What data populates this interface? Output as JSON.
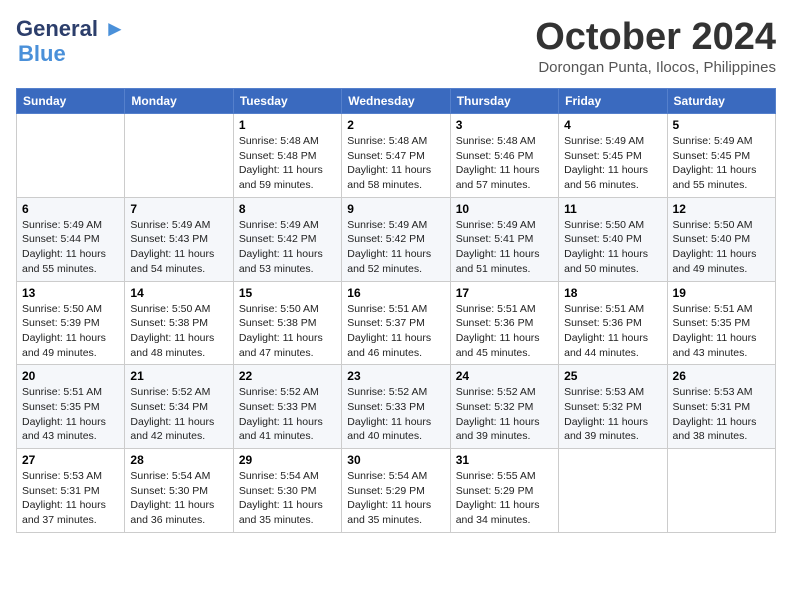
{
  "logo": {
    "line1": "General",
    "line2": "Blue"
  },
  "title": "October 2024",
  "location": "Dorongan Punta, Ilocos, Philippines",
  "days_of_week": [
    "Sunday",
    "Monday",
    "Tuesday",
    "Wednesday",
    "Thursday",
    "Friday",
    "Saturday"
  ],
  "weeks": [
    [
      {
        "day": "",
        "sunrise": "",
        "sunset": "",
        "daylight": ""
      },
      {
        "day": "",
        "sunrise": "",
        "sunset": "",
        "daylight": ""
      },
      {
        "day": "1",
        "sunrise": "Sunrise: 5:48 AM",
        "sunset": "Sunset: 5:48 PM",
        "daylight": "Daylight: 11 hours and 59 minutes."
      },
      {
        "day": "2",
        "sunrise": "Sunrise: 5:48 AM",
        "sunset": "Sunset: 5:47 PM",
        "daylight": "Daylight: 11 hours and 58 minutes."
      },
      {
        "day": "3",
        "sunrise": "Sunrise: 5:48 AM",
        "sunset": "Sunset: 5:46 PM",
        "daylight": "Daylight: 11 hours and 57 minutes."
      },
      {
        "day": "4",
        "sunrise": "Sunrise: 5:49 AM",
        "sunset": "Sunset: 5:45 PM",
        "daylight": "Daylight: 11 hours and 56 minutes."
      },
      {
        "day": "5",
        "sunrise": "Sunrise: 5:49 AM",
        "sunset": "Sunset: 5:45 PM",
        "daylight": "Daylight: 11 hours and 55 minutes."
      }
    ],
    [
      {
        "day": "6",
        "sunrise": "Sunrise: 5:49 AM",
        "sunset": "Sunset: 5:44 PM",
        "daylight": "Daylight: 11 hours and 55 minutes."
      },
      {
        "day": "7",
        "sunrise": "Sunrise: 5:49 AM",
        "sunset": "Sunset: 5:43 PM",
        "daylight": "Daylight: 11 hours and 54 minutes."
      },
      {
        "day": "8",
        "sunrise": "Sunrise: 5:49 AM",
        "sunset": "Sunset: 5:42 PM",
        "daylight": "Daylight: 11 hours and 53 minutes."
      },
      {
        "day": "9",
        "sunrise": "Sunrise: 5:49 AM",
        "sunset": "Sunset: 5:42 PM",
        "daylight": "Daylight: 11 hours and 52 minutes."
      },
      {
        "day": "10",
        "sunrise": "Sunrise: 5:49 AM",
        "sunset": "Sunset: 5:41 PM",
        "daylight": "Daylight: 11 hours and 51 minutes."
      },
      {
        "day": "11",
        "sunrise": "Sunrise: 5:50 AM",
        "sunset": "Sunset: 5:40 PM",
        "daylight": "Daylight: 11 hours and 50 minutes."
      },
      {
        "day": "12",
        "sunrise": "Sunrise: 5:50 AM",
        "sunset": "Sunset: 5:40 PM",
        "daylight": "Daylight: 11 hours and 49 minutes."
      }
    ],
    [
      {
        "day": "13",
        "sunrise": "Sunrise: 5:50 AM",
        "sunset": "Sunset: 5:39 PM",
        "daylight": "Daylight: 11 hours and 49 minutes."
      },
      {
        "day": "14",
        "sunrise": "Sunrise: 5:50 AM",
        "sunset": "Sunset: 5:38 PM",
        "daylight": "Daylight: 11 hours and 48 minutes."
      },
      {
        "day": "15",
        "sunrise": "Sunrise: 5:50 AM",
        "sunset": "Sunset: 5:38 PM",
        "daylight": "Daylight: 11 hours and 47 minutes."
      },
      {
        "day": "16",
        "sunrise": "Sunrise: 5:51 AM",
        "sunset": "Sunset: 5:37 PM",
        "daylight": "Daylight: 11 hours and 46 minutes."
      },
      {
        "day": "17",
        "sunrise": "Sunrise: 5:51 AM",
        "sunset": "Sunset: 5:36 PM",
        "daylight": "Daylight: 11 hours and 45 minutes."
      },
      {
        "day": "18",
        "sunrise": "Sunrise: 5:51 AM",
        "sunset": "Sunset: 5:36 PM",
        "daylight": "Daylight: 11 hours and 44 minutes."
      },
      {
        "day": "19",
        "sunrise": "Sunrise: 5:51 AM",
        "sunset": "Sunset: 5:35 PM",
        "daylight": "Daylight: 11 hours and 43 minutes."
      }
    ],
    [
      {
        "day": "20",
        "sunrise": "Sunrise: 5:51 AM",
        "sunset": "Sunset: 5:35 PM",
        "daylight": "Daylight: 11 hours and 43 minutes."
      },
      {
        "day": "21",
        "sunrise": "Sunrise: 5:52 AM",
        "sunset": "Sunset: 5:34 PM",
        "daylight": "Daylight: 11 hours and 42 minutes."
      },
      {
        "day": "22",
        "sunrise": "Sunrise: 5:52 AM",
        "sunset": "Sunset: 5:33 PM",
        "daylight": "Daylight: 11 hours and 41 minutes."
      },
      {
        "day": "23",
        "sunrise": "Sunrise: 5:52 AM",
        "sunset": "Sunset: 5:33 PM",
        "daylight": "Daylight: 11 hours and 40 minutes."
      },
      {
        "day": "24",
        "sunrise": "Sunrise: 5:52 AM",
        "sunset": "Sunset: 5:32 PM",
        "daylight": "Daylight: 11 hours and 39 minutes."
      },
      {
        "day": "25",
        "sunrise": "Sunrise: 5:53 AM",
        "sunset": "Sunset: 5:32 PM",
        "daylight": "Daylight: 11 hours and 39 minutes."
      },
      {
        "day": "26",
        "sunrise": "Sunrise: 5:53 AM",
        "sunset": "Sunset: 5:31 PM",
        "daylight": "Daylight: 11 hours and 38 minutes."
      }
    ],
    [
      {
        "day": "27",
        "sunrise": "Sunrise: 5:53 AM",
        "sunset": "Sunset: 5:31 PM",
        "daylight": "Daylight: 11 hours and 37 minutes."
      },
      {
        "day": "28",
        "sunrise": "Sunrise: 5:54 AM",
        "sunset": "Sunset: 5:30 PM",
        "daylight": "Daylight: 11 hours and 36 minutes."
      },
      {
        "day": "29",
        "sunrise": "Sunrise: 5:54 AM",
        "sunset": "Sunset: 5:30 PM",
        "daylight": "Daylight: 11 hours and 35 minutes."
      },
      {
        "day": "30",
        "sunrise": "Sunrise: 5:54 AM",
        "sunset": "Sunset: 5:29 PM",
        "daylight": "Daylight: 11 hours and 35 minutes."
      },
      {
        "day": "31",
        "sunrise": "Sunrise: 5:55 AM",
        "sunset": "Sunset: 5:29 PM",
        "daylight": "Daylight: 11 hours and 34 minutes."
      },
      {
        "day": "",
        "sunrise": "",
        "sunset": "",
        "daylight": ""
      },
      {
        "day": "",
        "sunrise": "",
        "sunset": "",
        "daylight": ""
      }
    ]
  ]
}
